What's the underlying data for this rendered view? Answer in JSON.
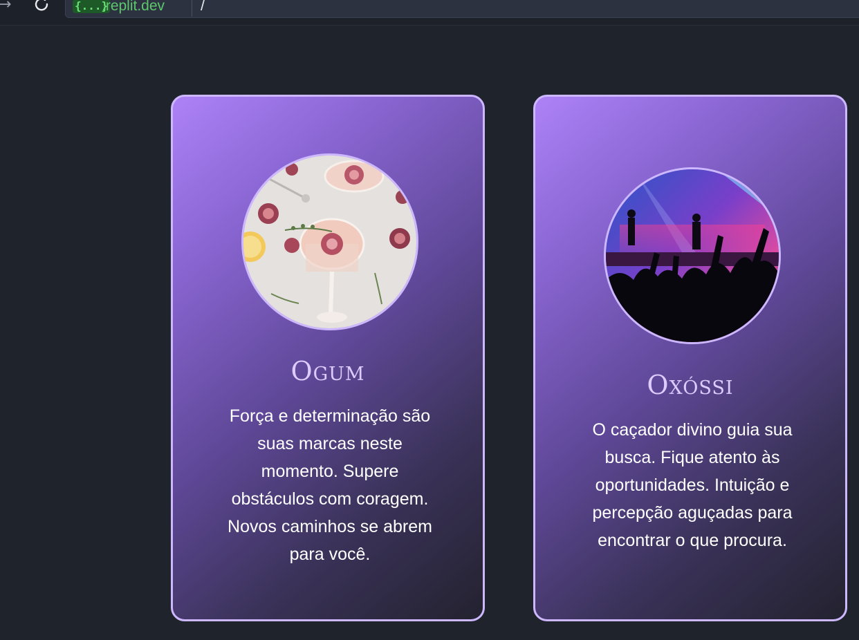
{
  "browser": {
    "forward_icon": "arrow-right-icon",
    "reload_icon": "reload-icon",
    "url_chip": "{...}",
    "url_domain": ".replit.dev",
    "url_path": "/"
  },
  "theme": {
    "background": "#1f232b",
    "card_border": "#cdb8ff",
    "card_gradient_start": "#ad82f7",
    "card_gradient_end": "#23222f",
    "title_color": "#dcccff"
  },
  "cards": [
    {
      "title": "Ogum",
      "lines": [
        "Força e determinação são",
        "suas marcas neste",
        "momento. Supere",
        "obstáculos com coragem.",
        "Novos caminhos se abrem",
        "para você."
      ],
      "image": "cocktail-glasses-with-figs-image"
    },
    {
      "title": "Oxóssi",
      "lines": [
        "O caçador divino guia sua",
        "busca. Fique atento às",
        "oportunidades. Intuição e",
        "percepção aguçadas para",
        "encontrar o que procura."
      ],
      "image": "concert-crowd-image"
    }
  ]
}
